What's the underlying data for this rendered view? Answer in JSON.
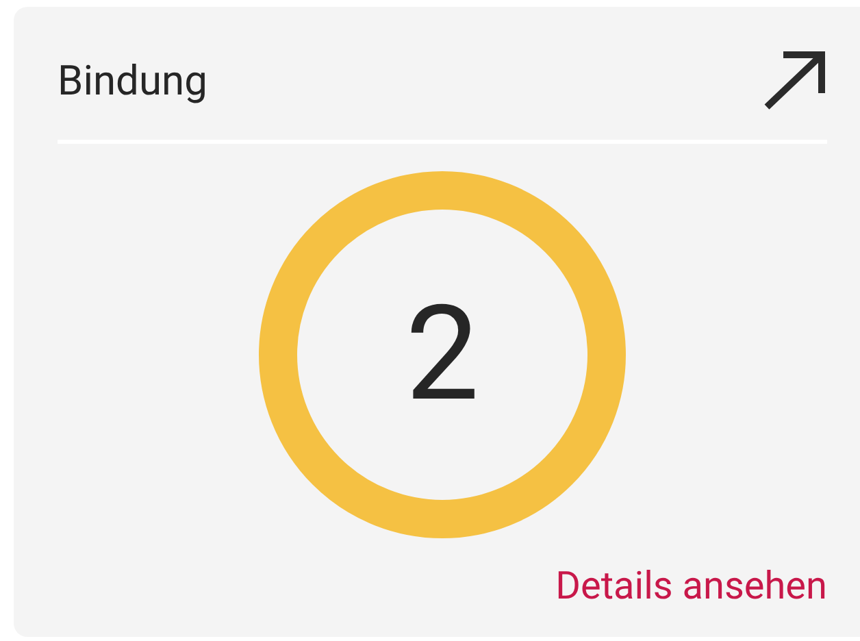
{
  "card": {
    "title": "Bindung",
    "value": "2",
    "link": "Details ansehen"
  }
}
